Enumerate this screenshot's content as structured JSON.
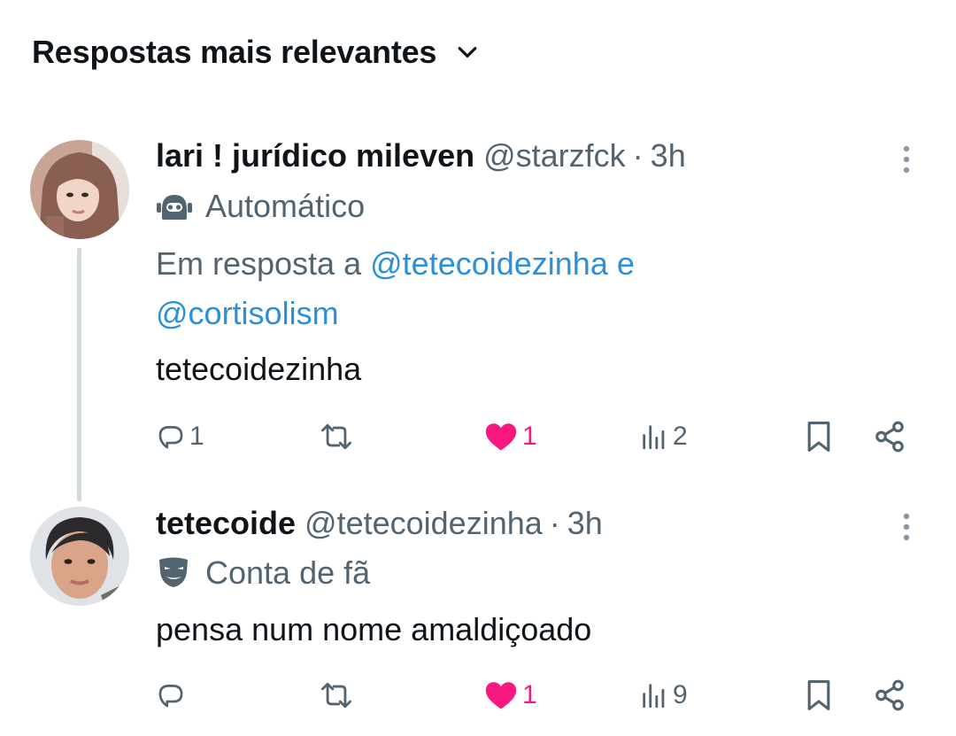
{
  "header": {
    "sort_label": "Respostas mais relevantes"
  },
  "tweets": [
    {
      "display_name": "lari ! jurídico mileven",
      "handle": "@starzfck",
      "separator": "·",
      "time": "3h",
      "label": "Automático",
      "label_icon": "robot-icon",
      "reply_prefix": "Em resposta a",
      "reply_mention_1": "@tetecoidezinha",
      "reply_joiner": "e",
      "reply_mention_2": "@cortisolism",
      "text": "tetecoidezinha",
      "replies": "1",
      "likes": "1",
      "views": "2",
      "liked": true
    },
    {
      "display_name": "tetecoide",
      "handle": "@tetecoidezinha",
      "separator": "·",
      "time": "3h",
      "label": "Conta de fã",
      "label_icon": "theater-masks-icon",
      "text": "pensa num nome amaldiçoado",
      "replies": "",
      "likes": "1",
      "views": "9",
      "liked": true
    }
  ],
  "colors": {
    "text": "#0f1419",
    "secondary": "#536471",
    "mention": "#2b90d9",
    "like": "#f91880",
    "thread_line": "#cfd9de"
  }
}
